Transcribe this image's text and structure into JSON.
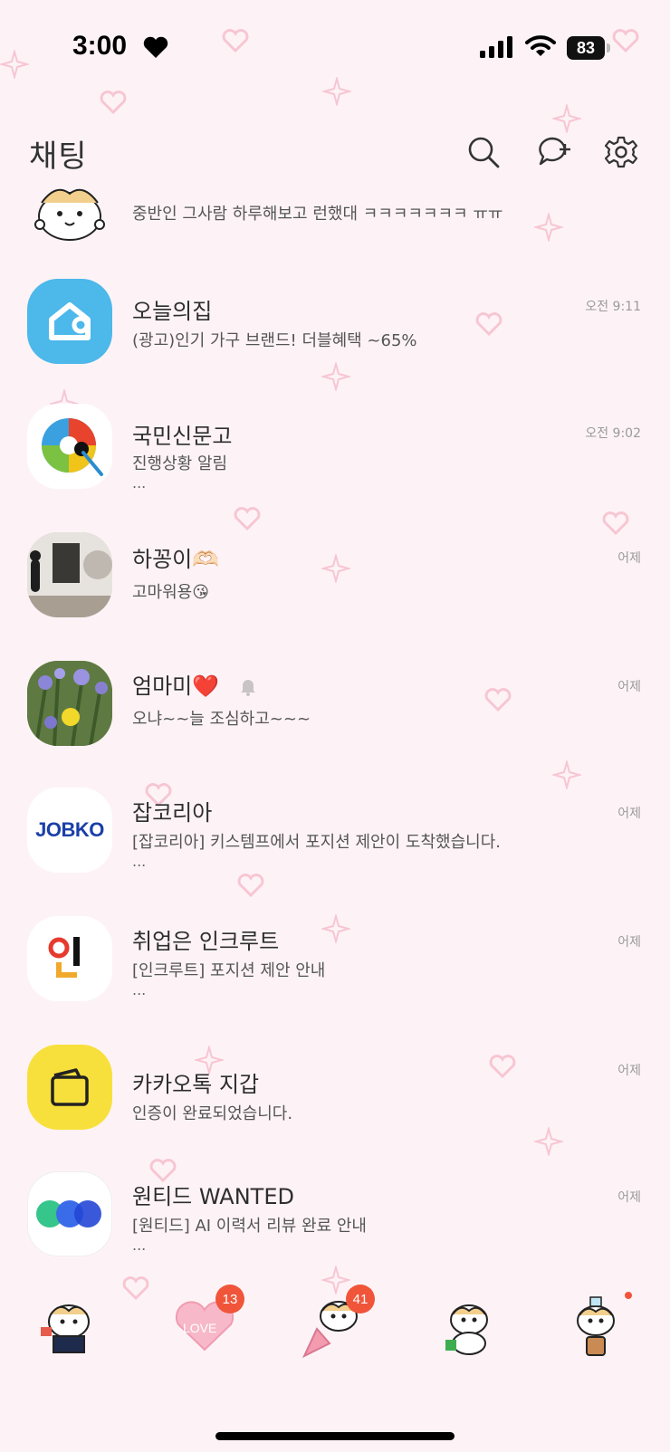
{
  "status_bar": {
    "time": "3:00",
    "battery": "83",
    "icons": [
      "heart-icon",
      "signal-icon",
      "wifi-icon",
      "battery-icon"
    ]
  },
  "header": {
    "title": "채팅",
    "icons": [
      "search-icon",
      "new-chat-icon",
      "settings-icon"
    ]
  },
  "chats": [
    {
      "name": "",
      "message": "중반인 그사람 하루해보고 런했대 ㅋㅋㅋㅋㅋㅋㅋ ㅠㅠ",
      "time": "",
      "more": "",
      "avatar": "hamster-sticker"
    },
    {
      "name": "오늘의집",
      "message": "(광고)인기 가구 브랜드! 더블혜택 ~65%",
      "time": "오전 9:11",
      "more": "",
      "avatar": "ohouse-logo",
      "color": "#35c5f0"
    },
    {
      "name": "국민신문고",
      "message": "진행상황 알림",
      "time": "오전 9:02",
      "more": "...",
      "avatar": "sinmungo-logo"
    },
    {
      "name": "하꽁이🫶🏻",
      "message": "고마워용😘",
      "time": "어제",
      "more": "",
      "avatar": "gallery-photo"
    },
    {
      "name": "엄마미❤️",
      "message": "오냐~~늘 조심하고~~~",
      "time": "어제",
      "more": "",
      "avatar": "flower-photo",
      "muted_icon": "lock-bell-icon"
    },
    {
      "name": "잡코리아",
      "message": "[잡코리아] 키스템프에서 포지션 제안이 도착했습니다.",
      "time": "어제",
      "more": "...",
      "avatar": "jobko-logo",
      "logo_text": "JOBKO"
    },
    {
      "name": "취업은 인크루트",
      "message": "[인크루트] 포지션 제안 안내",
      "time": "어제",
      "more": "...",
      "avatar": "incruit-logo"
    },
    {
      "name": "카카오톡 지갑",
      "message": "인증이 완료되었습니다.",
      "time": "어제",
      "more": "",
      "avatar": "kakao-wallet-logo",
      "color": "#f7e03c"
    },
    {
      "name": "원티드 WANTED",
      "message": "[원티드] AI 이력서 리뷰 완료 안내",
      "time": "어제",
      "more": "...",
      "avatar": "wanted-logo"
    }
  ],
  "bottom_nav": [
    {
      "name": "friends-tab",
      "badge": ""
    },
    {
      "name": "chats-tab",
      "badge": "13",
      "icon_text": "LOVE"
    },
    {
      "name": "openchat-tab",
      "badge": "41"
    },
    {
      "name": "shopping-tab",
      "badge": ""
    },
    {
      "name": "more-tab",
      "badge": "",
      "dot": true
    }
  ],
  "colors": {
    "background": "#fdf3f6",
    "badge": "#f0553a",
    "accent_pink": "#f7c6d3"
  }
}
